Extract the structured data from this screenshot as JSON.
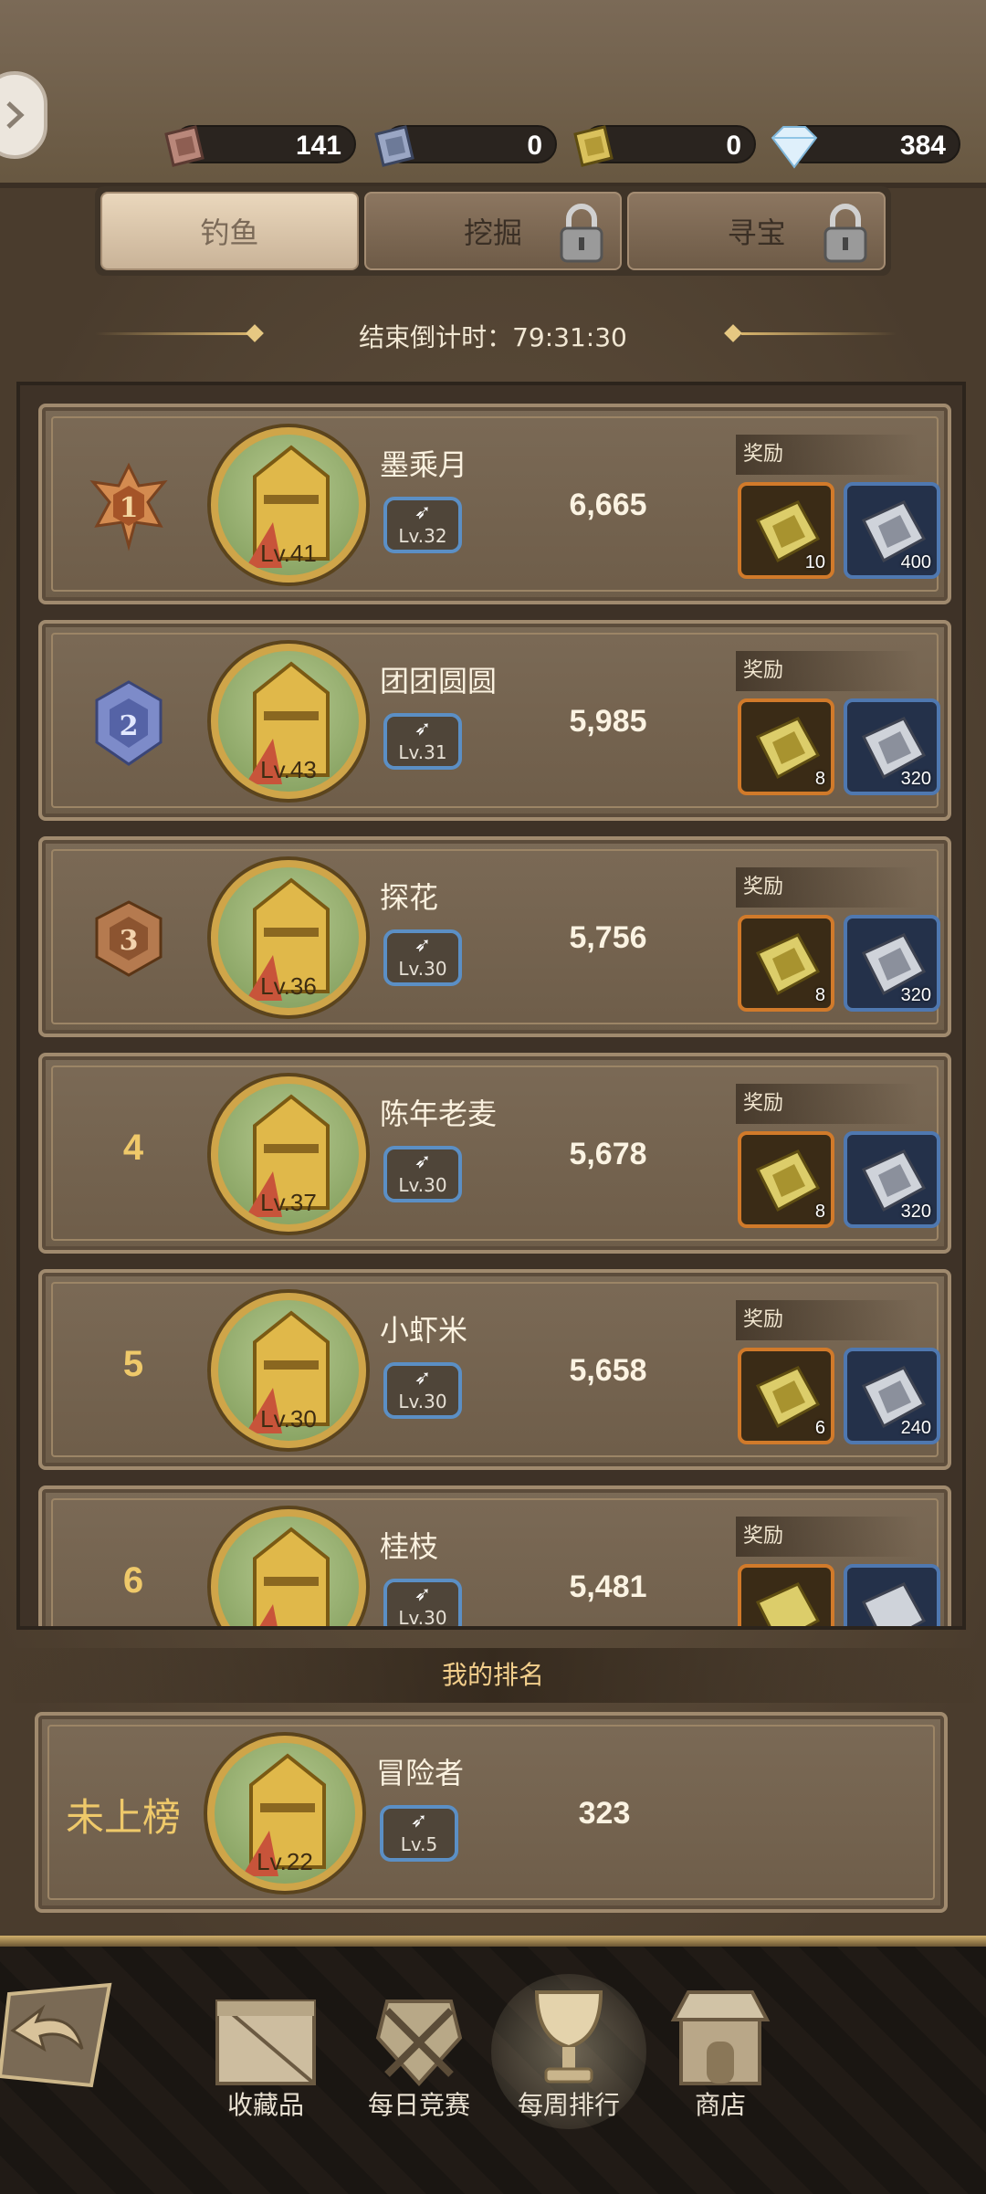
{
  "resources": [
    {
      "icon": "red-ore-icon",
      "value": "141"
    },
    {
      "icon": "blue-ore-icon",
      "value": "0"
    },
    {
      "icon": "gold-ore-icon",
      "value": "0"
    },
    {
      "icon": "diamond-icon",
      "value": "384"
    }
  ],
  "tabs": [
    {
      "label": "钓鱼",
      "active": true,
      "locked": false
    },
    {
      "label": "挖掘",
      "active": false,
      "locked": true
    },
    {
      "label": "寻宝",
      "active": false,
      "locked": true
    }
  ],
  "countdown": "结束倒计时：79:31:30",
  "reward_label": "奖励",
  "entries": [
    {
      "rank": "1",
      "name": "墨乘月",
      "avatar_level": "Lv.41",
      "fishing_level": "Lv.32",
      "score": "6,665",
      "reward_gold": "10",
      "reward_silver": "400"
    },
    {
      "rank": "2",
      "name": "团团圆圆",
      "avatar_level": "Lv.43",
      "fishing_level": "Lv.31",
      "score": "5,985",
      "reward_gold": "8",
      "reward_silver": "320"
    },
    {
      "rank": "3",
      "name": "探花",
      "avatar_level": "Lv.36",
      "fishing_level": "Lv.30",
      "score": "5,756",
      "reward_gold": "8",
      "reward_silver": "320"
    },
    {
      "rank": "4",
      "name": "陈年老麦",
      "avatar_level": "Lv.37",
      "fishing_level": "Lv.30",
      "score": "5,678",
      "reward_gold": "8",
      "reward_silver": "320"
    },
    {
      "rank": "5",
      "name": "小虾米",
      "avatar_level": "Lv.30",
      "fishing_level": "Lv.30",
      "score": "5,658",
      "reward_gold": "6",
      "reward_silver": "240"
    },
    {
      "rank": "6",
      "name": "桂枝",
      "avatar_level": "",
      "fishing_level": "Lv.30",
      "score": "5,481",
      "reward_gold": "",
      "reward_silver": ""
    }
  ],
  "my_rank": {
    "header": "我的排名",
    "rank_text": "未上榜",
    "name": "冒险者",
    "avatar_level": "Lv.22",
    "fishing_level": "Lv.5",
    "score": "323"
  },
  "nav": [
    {
      "label": "收藏品",
      "icon": "crate-icon",
      "active": false
    },
    {
      "label": "每日竞赛",
      "icon": "crossed-tools-icon",
      "active": false
    },
    {
      "label": "每周排行",
      "icon": "trophy-icon",
      "active": true
    },
    {
      "label": "商店",
      "icon": "shop-icon",
      "active": false
    }
  ]
}
